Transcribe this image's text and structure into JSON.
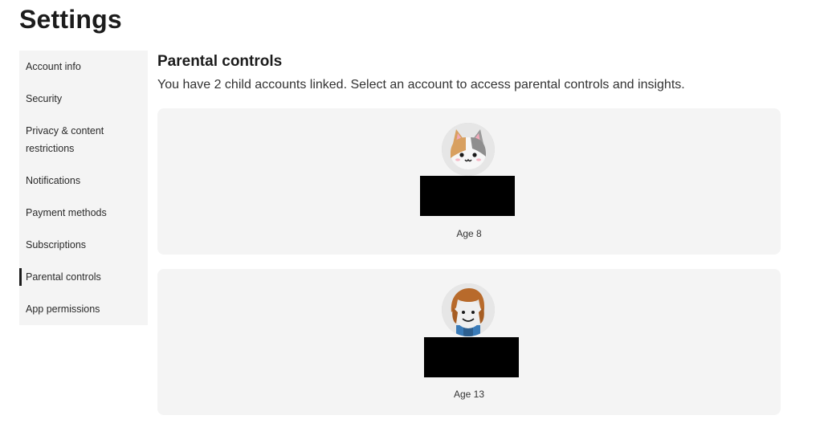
{
  "page": {
    "title": "Settings"
  },
  "sidebar": {
    "items": [
      {
        "label": "Account info",
        "active": false
      },
      {
        "label": "Security",
        "active": false
      },
      {
        "label": "Privacy & content",
        "label2": "restrictions",
        "active": false
      },
      {
        "label": "Notifications",
        "active": false
      },
      {
        "label": "Payment methods",
        "active": false
      },
      {
        "label": "Subscriptions",
        "active": false
      },
      {
        "label": "Parental controls",
        "active": true
      },
      {
        "label": "App permissions",
        "active": false
      }
    ]
  },
  "main": {
    "title": "Parental controls",
    "description": "You have 2 child accounts linked. Select an account to access parental controls and insights.",
    "accounts": [
      {
        "avatar": "cat-avatar-icon",
        "age_label": "Age 8"
      },
      {
        "avatar": "character-avatar-icon",
        "age_label": "Age 13"
      }
    ]
  },
  "colors": {
    "active_indicator": "#1c1c1c",
    "panel_bg": "#f4f4f4",
    "redaction": "#000000"
  }
}
